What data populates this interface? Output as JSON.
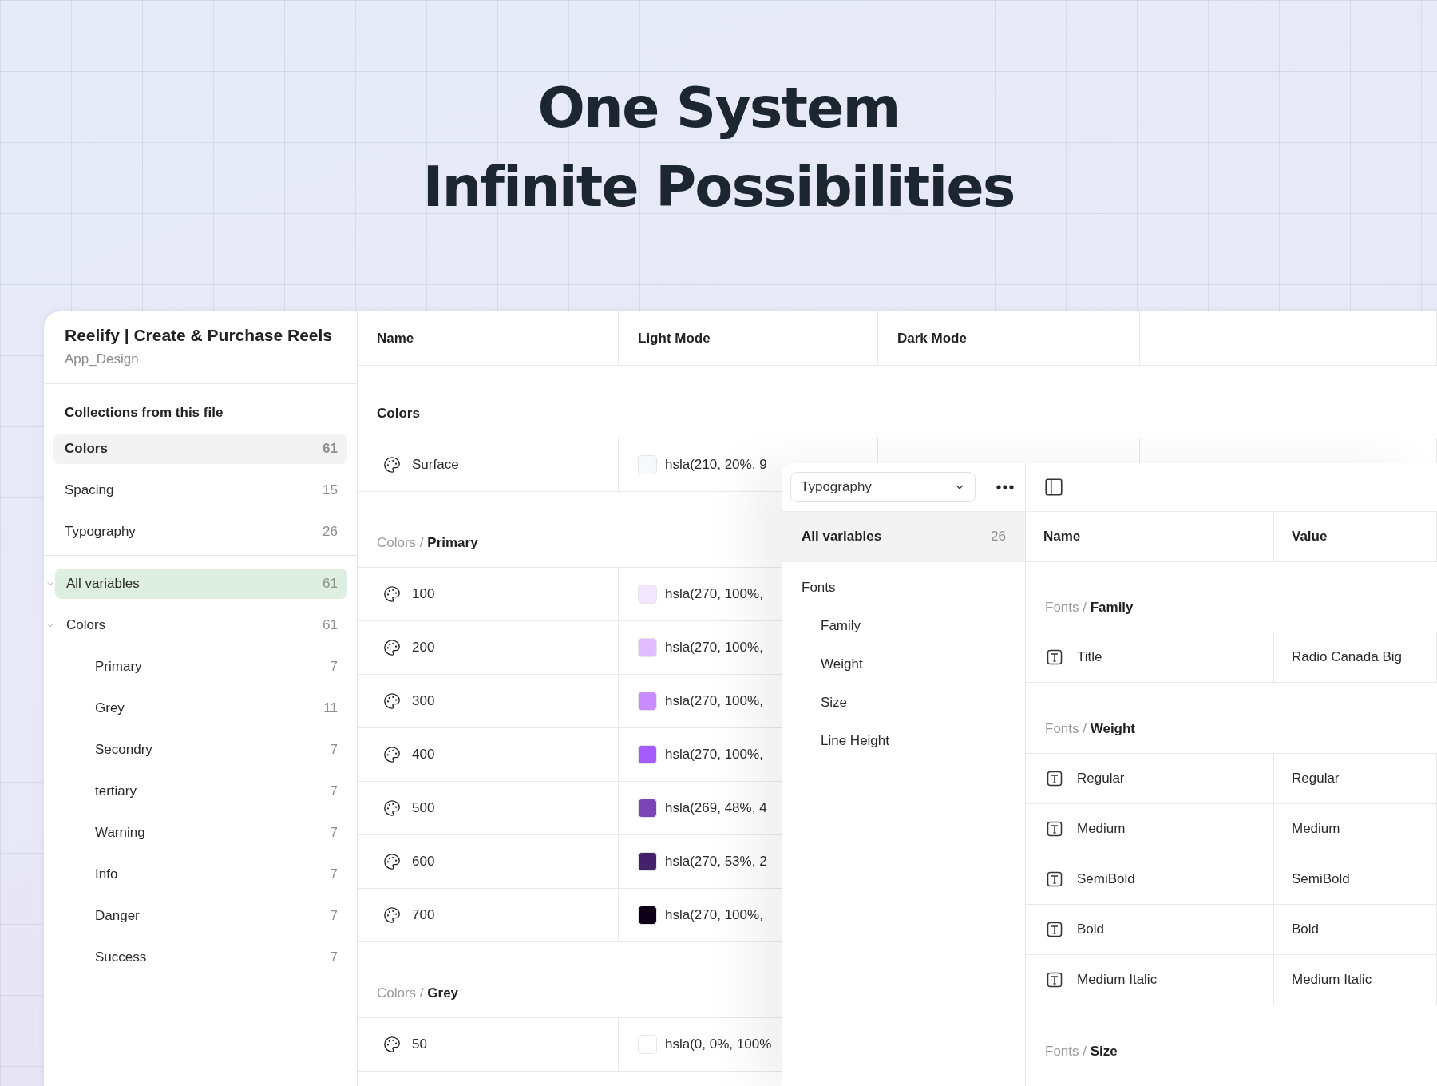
{
  "headline": [
    "One System",
    "Infinite Possibilities"
  ],
  "file": {
    "title": "Reelify | Create & Purchase Reels",
    "subtitle": "App_Design"
  },
  "collections": {
    "heading": "Collections from this file",
    "items": [
      {
        "label": "Colors",
        "count": "61",
        "selected": true
      },
      {
        "label": "Spacing",
        "count": "15",
        "selected": false
      },
      {
        "label": "Typography",
        "count": "26",
        "selected": false
      }
    ]
  },
  "variable_tree": [
    {
      "label": "All variables",
      "count": "61",
      "selected": true,
      "expanded": true
    },
    {
      "label": "Colors",
      "count": "61",
      "selected": false,
      "expanded": true,
      "children": [
        {
          "label": "Primary",
          "count": "7",
          "selected": false
        },
        {
          "label": "Grey",
          "count": "11",
          "selected": false
        },
        {
          "label": "Secondry",
          "count": "7",
          "selected": false
        },
        {
          "label": "tertiary",
          "count": "7",
          "selected": false
        },
        {
          "label": "Warning",
          "count": "7",
          "selected": false
        },
        {
          "label": "Info",
          "count": "7",
          "selected": false
        },
        {
          "label": "Danger",
          "count": "7",
          "selected": false
        },
        {
          "label": "Success",
          "count": "7",
          "selected": false
        }
      ]
    }
  ],
  "table": {
    "columns": [
      "Name",
      "Light Mode",
      "Dark Mode"
    ],
    "groups": [
      {
        "kind": "collection",
        "label": "Colors",
        "rows": [
          {
            "name": "Surface",
            "color": "#f7f9fa",
            "light_value": "hsla(210, 20%, 9"
          }
        ]
      },
      {
        "kind": "subgroup",
        "label": "Colors / **Primary**",
        "rows": [
          {
            "name": "100",
            "color": "#f3e6ff",
            "light_value": "hsla(270, 100%,"
          },
          {
            "name": "200",
            "color": "#e0bbff",
            "light_value": "hsla(270, 100%,"
          },
          {
            "name": "300",
            "color": "#c88cff",
            "light_value": "hsla(270, 100%,"
          },
          {
            "name": "400",
            "color": "#a55cff",
            "light_value": "hsla(270, 100%,"
          },
          {
            "name": "500",
            "color": "#7b45b8",
            "light_value": "hsla(269, 48%, 4"
          },
          {
            "name": "600",
            "color": "#45206b",
            "light_value": "hsla(270, 53%, 2"
          },
          {
            "name": "700",
            "color": "#0e0018",
            "light_value": "hsla(270, 100%,"
          }
        ]
      },
      {
        "kind": "subgroup",
        "label": "Colors / **Grey**",
        "rows": [
          {
            "name": "50",
            "color": "#ffffff",
            "light_value": "hsla(0, 0%, 100%"
          }
        ]
      }
    ]
  },
  "overlay": {
    "collection_select": "Typography",
    "sidebar": {
      "all": {
        "label": "All variables",
        "count": "26",
        "selected": true
      },
      "groups": [
        {
          "label": "Fonts",
          "selected": false,
          "children": [
            {
              "label": "Family",
              "selected": false
            },
            {
              "label": "Weight",
              "selected": false
            },
            {
              "label": "Size",
              "selected": false
            },
            {
              "label": "Line Height",
              "selected": false
            }
          ]
        }
      ]
    },
    "table": {
      "columns": [
        "Name",
        "Value"
      ],
      "groups": [
        {
          "label": "Fonts / **Family**",
          "rows": [
            {
              "name": "Title",
              "value": "Radio Canada Big"
            }
          ]
        },
        {
          "label": "Fonts / **Weight**",
          "rows": [
            {
              "name": "Regular",
              "value": "Regular"
            },
            {
              "name": "Medium",
              "value": "Medium"
            },
            {
              "name": "SemiBold",
              "value": "SemiBold"
            },
            {
              "name": "Bold",
              "value": "Bold"
            },
            {
              "name": "Medium Italic",
              "value": "Medium Italic"
            }
          ]
        },
        {
          "label": "Fonts / **Size**"
        }
      ]
    }
  }
}
